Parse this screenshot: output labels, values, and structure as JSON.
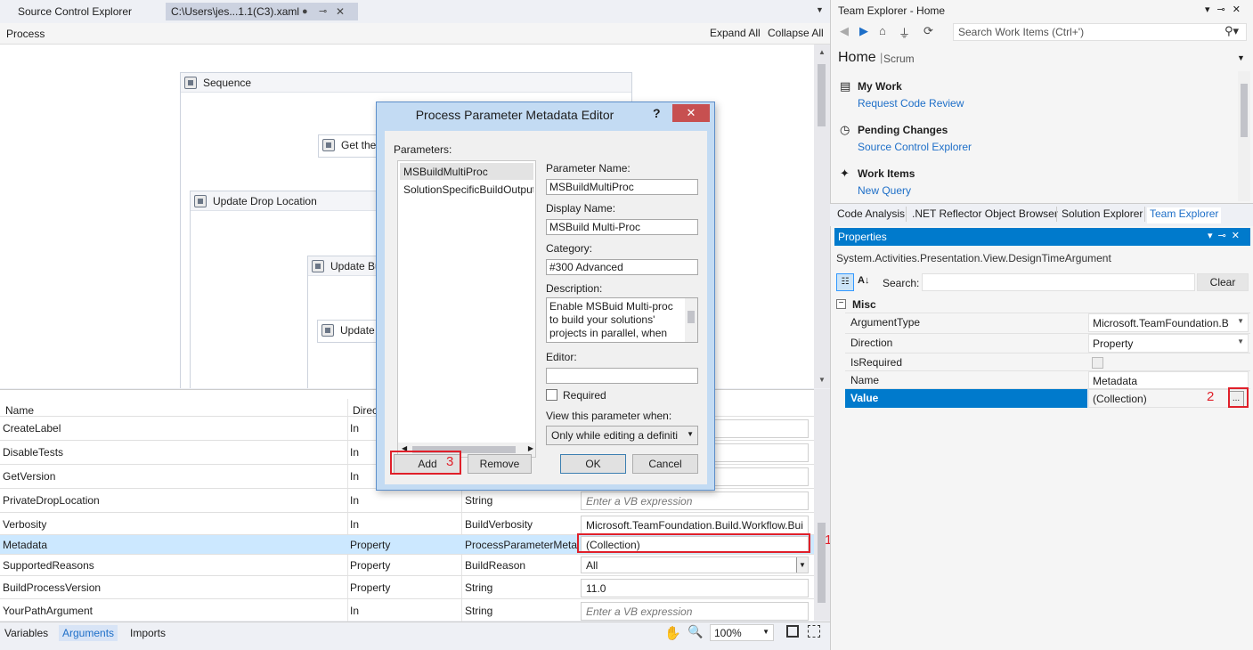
{
  "doc_tabs": {
    "source_control": "Source Control Explorer",
    "xaml": "C:\\Users\\jes...1.1(C3).xaml"
  },
  "workflow": {
    "breadcrumb": "Process",
    "expand_all": "Expand All",
    "collapse_all": "Collapse All",
    "activities": [
      "Sequence",
      "Get the",
      "Update Drop Location",
      "Update Bu",
      "Update"
    ]
  },
  "arguments": {
    "columns": [
      "Name",
      "Direc"
    ],
    "rows": [
      {
        "name": "CreateLabel",
        "direction": "In",
        "type": "",
        "default": ""
      },
      {
        "name": "DisableTests",
        "direction": "In",
        "type": "",
        "default": ""
      },
      {
        "name": "GetVersion",
        "direction": "In",
        "type": "",
        "default": ""
      },
      {
        "name": "PrivateDropLocation",
        "direction": "In",
        "type": "String",
        "default": "Enter a VB expression"
      },
      {
        "name": "Verbosity",
        "direction": "In",
        "type": "BuildVerbosity",
        "default": "Microsoft.TeamFoundation.Build.Workflow.Bui"
      },
      {
        "name": "Metadata",
        "direction": "Property",
        "type": "ProcessParameterMetad",
        "default": "(Collection)"
      },
      {
        "name": "SupportedReasons",
        "direction": "Property",
        "type": "BuildReason",
        "default": "All"
      },
      {
        "name": "BuildProcessVersion",
        "direction": "Property",
        "type": "String",
        "default": "11.0"
      },
      {
        "name": "YourPathArgument",
        "direction": "In",
        "type": "String",
        "default": "Enter a VB expression"
      }
    ]
  },
  "bottom_bar": {
    "tabs": [
      "Variables",
      "Arguments",
      "Imports"
    ],
    "zoom": "100%"
  },
  "team_explorer": {
    "title": "Team Explorer - Home",
    "search_placeholder": "Search Work Items (Ctrl+')",
    "home": "Home",
    "project": "Scrum",
    "sections": [
      {
        "title": "My Work",
        "link": "Request Code Review"
      },
      {
        "title": "Pending Changes",
        "link": "Source Control Explorer"
      },
      {
        "title": "Work Items",
        "link": "New Query"
      }
    ],
    "tabs": [
      "Code Analysis",
      ".NET Reflector Object Browser",
      "Solution Explorer",
      "Team Explorer"
    ]
  },
  "properties": {
    "title": "Properties",
    "object_type": "System.Activities.Presentation.View.DesignTimeArgument",
    "search_label": "Search:",
    "clear": "Clear",
    "category": "Misc",
    "rows": [
      {
        "name": "ArgumentType",
        "value": "Microsoft.TeamFoundation.B"
      },
      {
        "name": "Direction",
        "value": "Property"
      },
      {
        "name": "IsRequired",
        "value": ""
      },
      {
        "name": "Name",
        "value": "Metadata"
      },
      {
        "name": "Value",
        "value": "(Collection)"
      }
    ],
    "ellipsis": "..."
  },
  "dialog": {
    "title": "Process Parameter Metadata Editor",
    "help": "?",
    "parameters_label": "Parameters:",
    "parameters": [
      "MSBuildMultiProc",
      "SolutionSpecificBuildOutputs"
    ],
    "param_name_label": "Parameter Name:",
    "param_name": "MSBuildMultiProc",
    "display_name_label": "Display Name:",
    "display_name": "MSBuild Multi-Proc",
    "category_label": "Category:",
    "category": "#300 Advanced",
    "description_label": "Description:",
    "description": "Enable MSBuid Multi-proc to build your solutions' projects in parallel, when",
    "editor_label": "Editor:",
    "editor": "",
    "required_label": "Required",
    "view_when_label": "View this parameter when:",
    "view_when": "Only while editing a definiti",
    "buttons": {
      "add": "Add",
      "remove": "Remove",
      "ok": "OK",
      "cancel": "Cancel"
    }
  },
  "callouts": [
    "1",
    "2",
    "3"
  ],
  "colors": {
    "accent": "#007acc",
    "callout": "#e0202a",
    "dialog_frame": "#c3dbf3",
    "close_button": "#c75050"
  }
}
